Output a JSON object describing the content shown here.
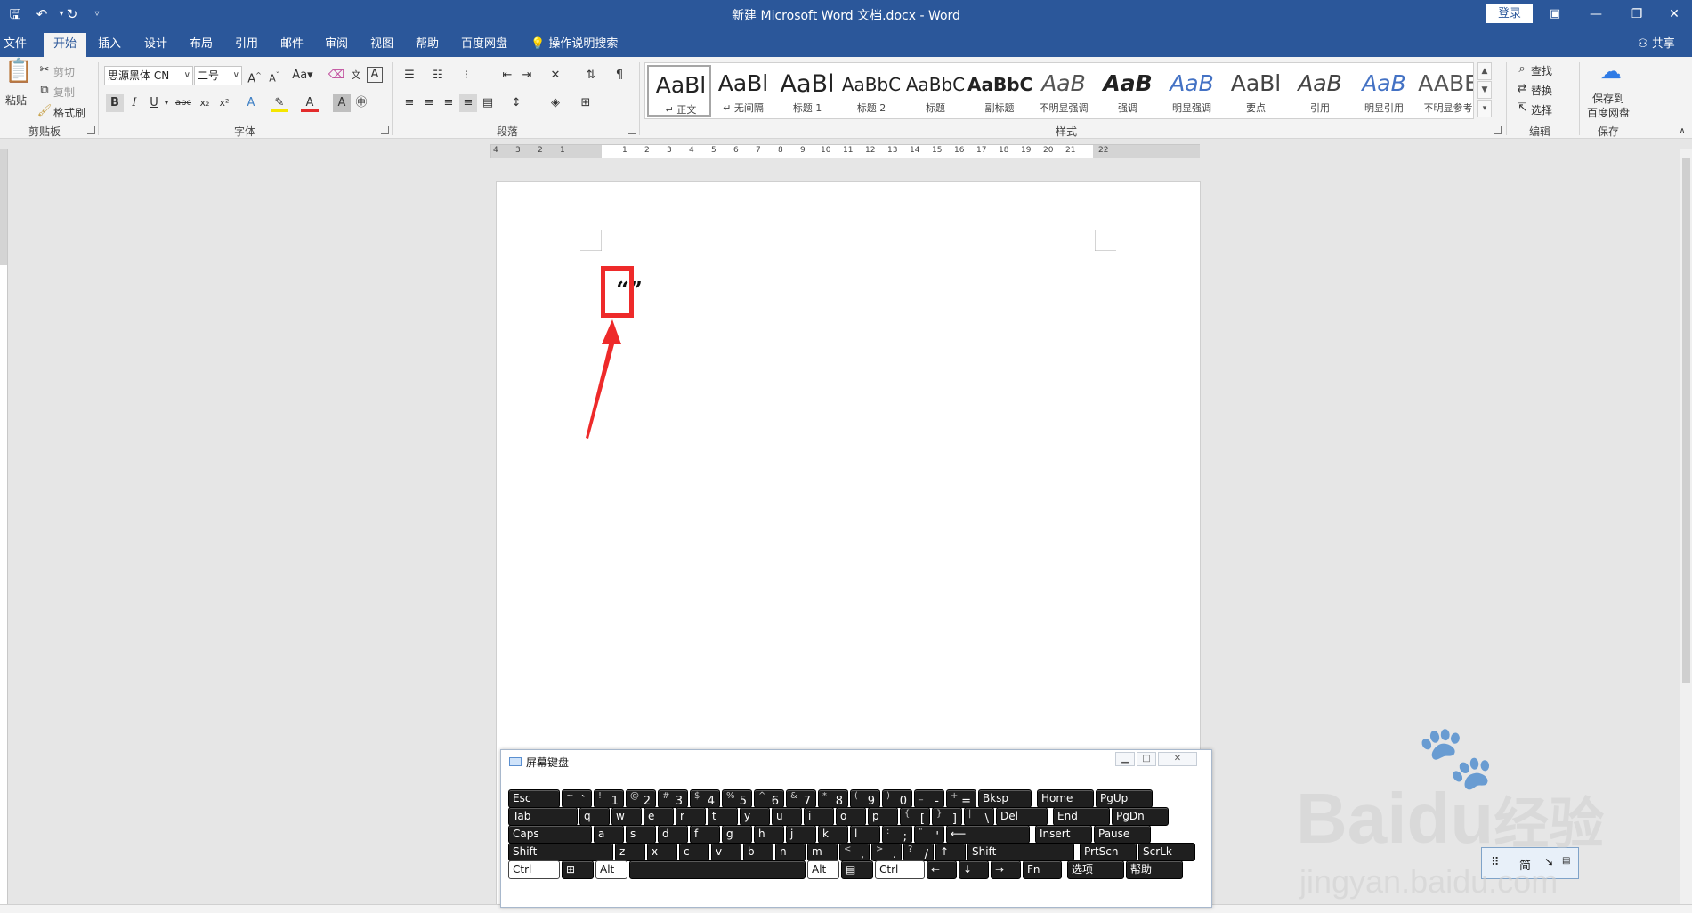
{
  "titlebar": {
    "title": "新建 Microsoft Word 文档.docx  -  Word",
    "login_label": "登录",
    "bg_color": "#2b579a"
  },
  "quick_access": {
    "icons": [
      "save-icon",
      "undo-icon",
      "redo-icon",
      "customize-icon"
    ]
  },
  "tabs": [
    {
      "label": "文件"
    },
    {
      "label": "开始"
    },
    {
      "label": "插入"
    },
    {
      "label": "设计"
    },
    {
      "label": "布局"
    },
    {
      "label": "引用"
    },
    {
      "label": "邮件"
    },
    {
      "label": "审阅"
    },
    {
      "label": "视图"
    },
    {
      "label": "帮助"
    },
    {
      "label": "百度网盘"
    }
  ],
  "tell_me": "操作说明搜索",
  "share": "共享",
  "clipboard": {
    "paste": "粘贴",
    "cut": "剪切",
    "copy": "复制",
    "format_painter": "格式刷",
    "group": "剪贴板"
  },
  "font": {
    "name": "思源黑体 CN",
    "size": "二号",
    "group": "字体"
  },
  "paragraph": {
    "group": "段落"
  },
  "styles": {
    "group": "样式",
    "items": [
      {
        "preview": "AaBl",
        "name": "↵ 正文"
      },
      {
        "preview": "AaBl",
        "name": "↵ 无间隔"
      },
      {
        "preview": "AaBl",
        "name": "标题 1"
      },
      {
        "preview": "AaBbC",
        "name": "标题 2"
      },
      {
        "preview": "AaBbC",
        "name": "标题"
      },
      {
        "preview": "AaBbC",
        "name": "副标题"
      },
      {
        "preview": "AaB",
        "name": "不明显强调"
      },
      {
        "preview": "AaB",
        "name": "强调"
      },
      {
        "preview": "AaB",
        "name": "明显强调"
      },
      {
        "preview": "AaBl",
        "name": "要点"
      },
      {
        "preview": "AaB",
        "name": "引用"
      },
      {
        "preview": "AaB",
        "name": "明显引用"
      },
      {
        "preview": "AABE",
        "name": "不明显参考"
      }
    ]
  },
  "editing": {
    "find": "查找",
    "replace": "替换",
    "select": "选择",
    "group": "编辑"
  },
  "save_baidu": {
    "line1": "保存到",
    "line2": "百度网盘",
    "group": "保存"
  },
  "ruler": {
    "numbers": [
      "4",
      "3",
      "2",
      "1",
      "",
      "1",
      "2",
      "3",
      "4",
      "5",
      "6",
      "7",
      "8",
      "9",
      "10",
      "11",
      "12",
      "13",
      "14",
      "15",
      "16",
      "17",
      "18",
      "19",
      "20",
      "21",
      "22"
    ]
  },
  "document": {
    "content": "“”"
  },
  "osk": {
    "title": "屏幕键盘",
    "rows": [
      [
        {
          "sub": "",
          "main": "",
          "label": "Esc"
        },
        {
          "sub": "~",
          "main": "`",
          "label": ""
        },
        {
          "sub": "!",
          "main": "1",
          "label": ""
        },
        {
          "sub": "@",
          "main": "2",
          "label": ""
        },
        {
          "sub": "#",
          "main": "3",
          "label": ""
        },
        {
          "sub": "$",
          "main": "4",
          "label": ""
        },
        {
          "sub": "%",
          "main": "5",
          "label": ""
        },
        {
          "sub": "^",
          "main": "6",
          "label": ""
        },
        {
          "sub": "&",
          "main": "7",
          "label": ""
        },
        {
          "sub": "*",
          "main": "8",
          "label": ""
        },
        {
          "sub": "(",
          "main": "9",
          "label": ""
        },
        {
          "sub": ")",
          "main": "0",
          "label": ""
        },
        {
          "sub": "_",
          "main": "-",
          "label": ""
        },
        {
          "sub": "+",
          "main": "=",
          "label": ""
        },
        {
          "sub": "",
          "main": "",
          "label": "Bksp"
        },
        {
          "sub": "",
          "main": "",
          "label": "Home"
        },
        {
          "sub": "",
          "main": "",
          "label": "PgUp"
        }
      ],
      [
        {
          "label": "Tab"
        },
        {
          "label": "q"
        },
        {
          "label": "w"
        },
        {
          "label": "e"
        },
        {
          "label": "r"
        },
        {
          "label": "t"
        },
        {
          "label": "y"
        },
        {
          "label": "u"
        },
        {
          "label": "i"
        },
        {
          "label": "o"
        },
        {
          "label": "p"
        },
        {
          "sub": "{",
          "main": "[",
          "label": ""
        },
        {
          "sub": "}",
          "main": "]",
          "label": ""
        },
        {
          "sub": "|",
          "main": "\\",
          "label": ""
        },
        {
          "label": "Del"
        },
        {
          "label": "End"
        },
        {
          "label": "PgDn"
        }
      ],
      [
        {
          "label": "Caps"
        },
        {
          "label": "a"
        },
        {
          "label": "s"
        },
        {
          "label": "d"
        },
        {
          "label": "f"
        },
        {
          "label": "g"
        },
        {
          "label": "h"
        },
        {
          "label": "j"
        },
        {
          "label": "k"
        },
        {
          "label": "l"
        },
        {
          "sub": ":",
          "main": ";",
          "label": ""
        },
        {
          "sub": "\"",
          "main": "'",
          "label": ""
        },
        {
          "label": "⟵"
        },
        {
          "label": "Insert"
        },
        {
          "label": "Pause"
        }
      ],
      [
        {
          "label": "Shift"
        },
        {
          "label": "z"
        },
        {
          "label": "x"
        },
        {
          "label": "c"
        },
        {
          "label": "v"
        },
        {
          "label": "b"
        },
        {
          "label": "n"
        },
        {
          "label": "m"
        },
        {
          "sub": "<",
          "main": ",",
          "label": ""
        },
        {
          "sub": ">",
          "main": ".",
          "label": ""
        },
        {
          "sub": "?",
          "main": "/",
          "label": ""
        },
        {
          "label": "↑"
        },
        {
          "label": "Shift"
        },
        {
          "label": "PrtScn"
        },
        {
          "label": "ScrLk"
        }
      ],
      [
        {
          "label": "Ctrl"
        },
        {
          "label": "⊞"
        },
        {
          "label": "Alt"
        },
        {
          "label": ""
        },
        {
          "label": "Alt"
        },
        {
          "label": "▤"
        },
        {
          "label": "Ctrl"
        },
        {
          "label": "←"
        },
        {
          "label": "↓"
        },
        {
          "label": "→"
        },
        {
          "label": "Fn"
        },
        {
          "label": "选项"
        },
        {
          "label": "帮助"
        }
      ]
    ]
  },
  "ime": {
    "mode": "简"
  },
  "watermark": {
    "brand": "Bai",
    "brand2": "du",
    "cn": "经验",
    "url": "jingyan.baidu.com"
  },
  "colors": {
    "accent": "#2b579a",
    "highlight_red": "#ee2a2a"
  }
}
